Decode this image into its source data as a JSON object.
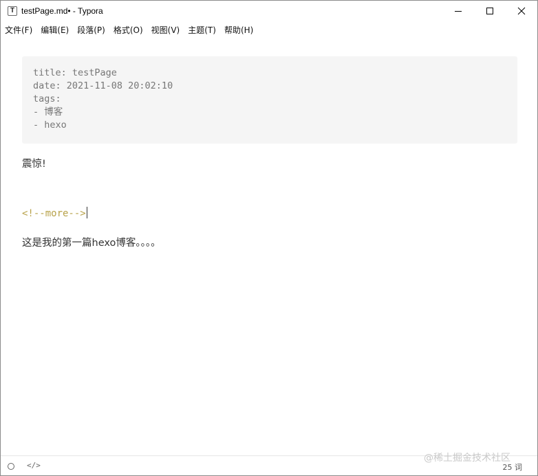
{
  "window": {
    "app_icon_letter": "T",
    "title": "testPage.md• - Typora",
    "controls": [
      "minimize",
      "maximize",
      "close"
    ]
  },
  "menu": {
    "items": [
      "文件(F)",
      "编辑(E)",
      "段落(P)",
      "格式(O)",
      "视图(V)",
      "主题(T)",
      "帮助(H)"
    ]
  },
  "document": {
    "front_matter": [
      "title: testPage",
      "date: 2021-11-08 20:02:10",
      "tags:",
      "- 博客",
      "- hexo"
    ],
    "paragraph_1": "震惊!",
    "more_comment": "<!--more-->",
    "paragraph_2": "这是我的第一篇hexo博客。。。。"
  },
  "statusbar": {
    "word_count": "25 词",
    "watermark": "@稀土掘金技术社区"
  },
  "colors": {
    "front_matter_bg": "#f5f5f5",
    "comment_color": "#b8a24a"
  }
}
